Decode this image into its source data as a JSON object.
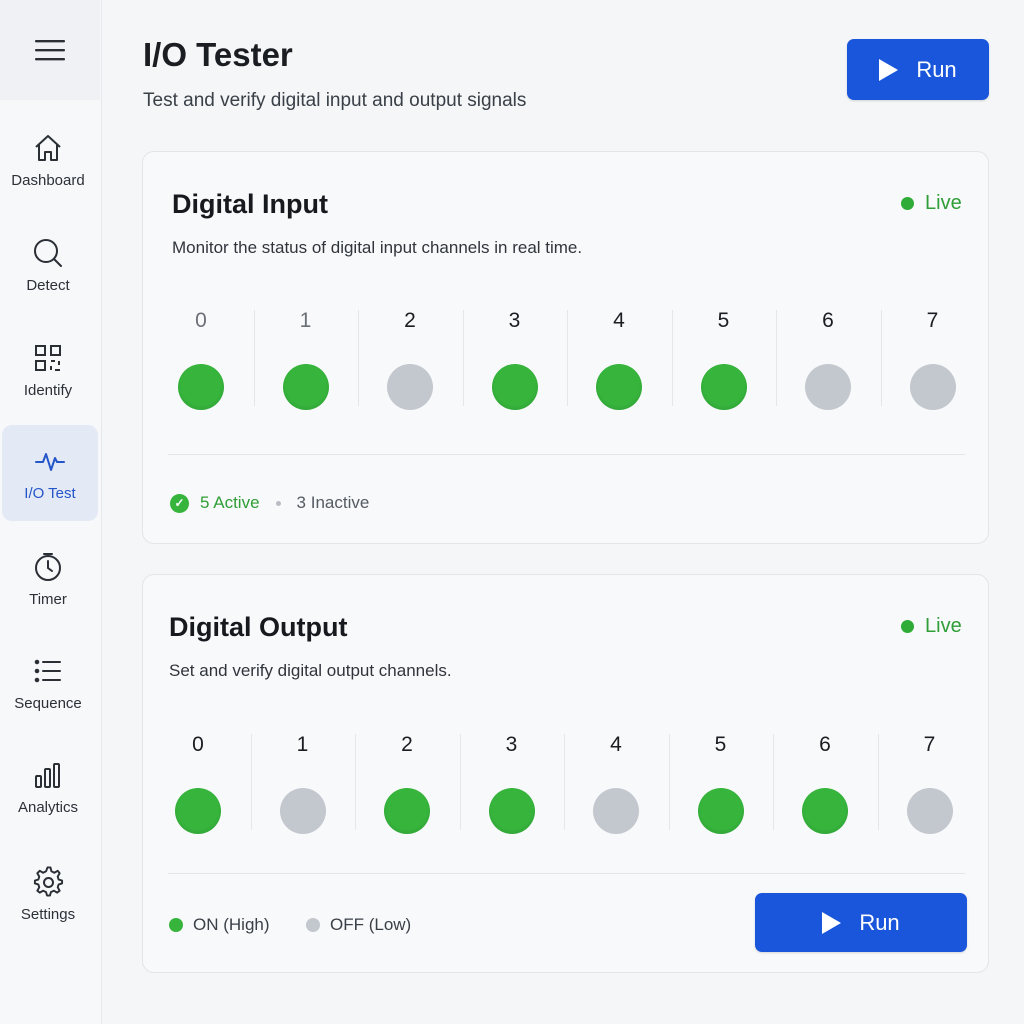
{
  "sidebar": {
    "menu_icon": "hamburger-icon",
    "items": [
      {
        "label": "Dashboard",
        "icon": "home-icon",
        "active": false
      },
      {
        "label": "Detect",
        "icon": "search-icon",
        "active": false
      },
      {
        "label": "Identify",
        "icon": "qr-code-icon",
        "active": false
      },
      {
        "label": "I/O Test",
        "icon": "pulse-icon",
        "active": true
      },
      {
        "label": "Timer",
        "icon": "clock-icon",
        "active": false
      },
      {
        "label": "Sequence",
        "icon": "list-icon",
        "active": false
      },
      {
        "label": "Analytics",
        "icon": "bar-chart-icon",
        "active": false
      },
      {
        "label": "Settings",
        "icon": "gear-icon",
        "active": false
      }
    ]
  },
  "header": {
    "title": "I/O Tester",
    "subtitle": "Test and verify digital input and output signals",
    "run_label": "Run"
  },
  "digital_input": {
    "title": "Digital Input",
    "status": "Live",
    "description": "Monitor the status of digital input channels in real time.",
    "channels": [
      {
        "num": "0",
        "on": true
      },
      {
        "num": "1",
        "on": true
      },
      {
        "num": "2",
        "on": false
      },
      {
        "num": "3",
        "on": true
      },
      {
        "num": "4",
        "on": true
      },
      {
        "num": "5",
        "on": true
      },
      {
        "num": "6",
        "on": false
      },
      {
        "num": "7",
        "on": false
      }
    ],
    "active_text": "5 Active",
    "inactive_text": "3 Inactive"
  },
  "digital_output": {
    "title": "Digital Output",
    "status": "Live",
    "description": "Set and verify digital output channels.",
    "channels": [
      {
        "num": "0",
        "on": true
      },
      {
        "num": "1",
        "on": false
      },
      {
        "num": "2",
        "on": true
      },
      {
        "num": "3",
        "on": true
      },
      {
        "num": "4",
        "on": false
      },
      {
        "num": "5",
        "on": true
      },
      {
        "num": "6",
        "on": true
      },
      {
        "num": "7",
        "on": false
      }
    ],
    "legend_on": "ON (High)",
    "legend_off": "OFF (Low)",
    "run_label": "Run"
  },
  "colors": {
    "accent": "#1a56db",
    "on": "#36b43c",
    "off": "#c3c7ce",
    "live": "#2f9e36"
  }
}
